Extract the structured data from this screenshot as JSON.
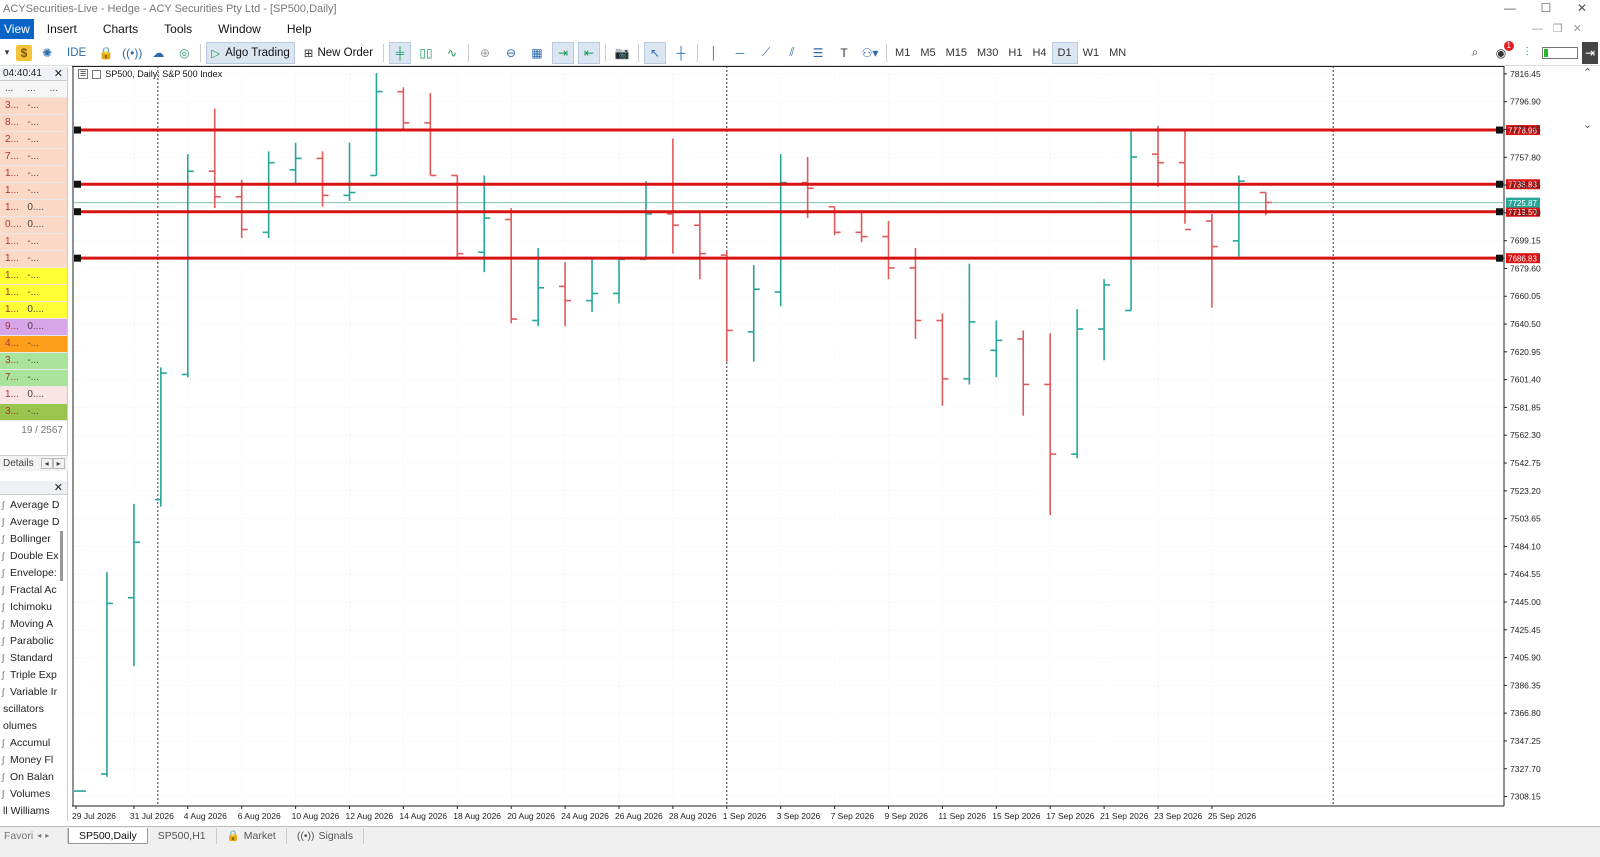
{
  "window": {
    "title": "ACYSecurities-Live - Hedge - ACY Securities Pty Ltd - [SP500,Daily]",
    "controls": [
      "—",
      "☐",
      "✕"
    ],
    "mdi_controls": [
      "—",
      "❐",
      "✕"
    ]
  },
  "menu": [
    "View",
    "Insert",
    "Charts",
    "Tools",
    "Window",
    "Help"
  ],
  "toolbar": {
    "ide": "IDE",
    "algo_trading": "Algo Trading",
    "new_order": "New Order",
    "timeframes": [
      "M1",
      "M5",
      "M15",
      "M30",
      "H1",
      "H4",
      "D1",
      "W1",
      "MN"
    ],
    "active_timeframe": "D1",
    "notification_count": "1"
  },
  "market_watch": {
    "time": "04:40:41",
    "headers": [
      "...",
      "...",
      "..."
    ],
    "rows": [
      {
        "a": "3...",
        "b": "-...",
        "color": "#fbd9c6"
      },
      {
        "a": "8...",
        "b": "-...",
        "color": "#fbd9c6"
      },
      {
        "a": "2...",
        "b": "-...",
        "color": "#fbd9c6"
      },
      {
        "a": "7...",
        "b": "-...",
        "color": "#fbd9c6"
      },
      {
        "a": "1...",
        "b": "-...",
        "color": "#fbd9c6"
      },
      {
        "a": "1...",
        "b": "-...",
        "color": "#fbd9c6"
      },
      {
        "a": "1...",
        "b": "0....",
        "color": "#fbd9c6"
      },
      {
        "a": "0....",
        "b": "0....",
        "color": "#fbd9c6"
      },
      {
        "a": "1...",
        "b": "-...",
        "color": "#fbd9c6"
      },
      {
        "a": "1...",
        "b": "-...",
        "color": "#fbd9c6"
      },
      {
        "a": "1...",
        "b": "-...",
        "color": "#ffff33"
      },
      {
        "a": "1...",
        "b": "-...",
        "color": "#ffff33"
      },
      {
        "a": "1...",
        "b": "0....",
        "color": "#ffff33"
      },
      {
        "a": "9...",
        "b": "0....",
        "color": "#d7a6e8"
      },
      {
        "a": "4...",
        "b": "-...",
        "color": "#ff9e1a"
      },
      {
        "a": "3...",
        "b": "-...",
        "color": "#a9e49a"
      },
      {
        "a": "7...",
        "b": "-...",
        "color": "#a9e49a"
      },
      {
        "a": "1...",
        "b": "0....",
        "color": "#fde4e4"
      },
      {
        "a": "3...",
        "b": "-...",
        "color": "#99c44d"
      }
    ],
    "count": "19 / 2567",
    "details_tab": "Details"
  },
  "navigator": {
    "items": [
      {
        "label": "Average D",
        "indent": true
      },
      {
        "label": "Average D",
        "indent": true
      },
      {
        "label": "Bollinger",
        "indent": true
      },
      {
        "label": "Double Ex",
        "indent": true
      },
      {
        "label": "Envelope:",
        "indent": true
      },
      {
        "label": "Fractal Ac",
        "indent": true
      },
      {
        "label": "Ichimoku",
        "indent": true
      },
      {
        "label": "Moving A",
        "indent": true
      },
      {
        "label": "Parabolic",
        "indent": true
      },
      {
        "label": "Standard",
        "indent": true
      },
      {
        "label": "Triple Exp",
        "indent": true
      },
      {
        "label": "Variable Ir",
        "indent": true
      },
      {
        "label": "scillators",
        "indent": false
      },
      {
        "label": "olumes",
        "indent": false
      },
      {
        "label": "Accumul",
        "indent": true
      },
      {
        "label": "Money Fl",
        "indent": true
      },
      {
        "label": "On Balan",
        "indent": true
      },
      {
        "label": "Volumes",
        "indent": true
      },
      {
        "label": "ll Williams",
        "indent": false
      }
    ]
  },
  "bottom_tabs": {
    "favorites": "Favori",
    "tabs": [
      "SP500,Daily",
      "SP500,H1",
      "Market",
      "Signals"
    ],
    "active": "SP500,Daily"
  },
  "chart_data": {
    "type": "bar",
    "symbol_label": "SP500, Daily:  S&P 500 Index",
    "colors": {
      "up": "#26a69a",
      "down": "#e05a5a",
      "level_line": "#d81313",
      "bid_line": "#7fbfb0",
      "current_tag": "#26a69a"
    },
    "y_ticks": [
      7816.45,
      7796.9,
      7777.35,
      7757.8,
      7738.25,
      7718.7,
      7699.15,
      7679.6,
      7660.05,
      7640.5,
      7620.95,
      7601.4,
      7581.85,
      7562.3,
      7542.75,
      7523.2,
      7503.65,
      7484.1,
      7464.55,
      7445.0,
      7425.45,
      7405.9,
      7386.35,
      7366.8,
      7347.25,
      7327.7,
      7308.15
    ],
    "ylim": [
      7301.5,
      7822.0
    ],
    "x_labels": [
      "29 Jul 2026",
      "31 Jul 2026",
      "4 Aug 2026",
      "6 Aug 2026",
      "10 Aug 2026",
      "12 Aug 2026",
      "14 Aug 2026",
      "18 Aug 2026",
      "20 Aug 2026",
      "24 Aug 2026",
      "26 Aug 2026",
      "28 Aug 2026",
      "1 Sep 2026",
      "3 Sep 2026",
      "7 Sep 2026",
      "9 Sep 2026",
      "11 Sep 2026",
      "15 Sep 2026",
      "17 Sep 2026",
      "21 Sep 2026",
      "23 Sep 2026",
      "25 Sep 2026"
    ],
    "x_label_bars": [
      0,
      2,
      4,
      6,
      8,
      10,
      12,
      14,
      16,
      18,
      20,
      22,
      24,
      26,
      28,
      30,
      32,
      34,
      36,
      38,
      40,
      42
    ],
    "vlines_at_bar": [
      3,
      24,
      46.5
    ],
    "horizontal_levels": [
      7776.96,
      7738.83,
      7719.5,
      7686.83
    ],
    "level_labels": [
      "7776.96",
      "7738.83",
      "7719.50",
      "7686.83"
    ],
    "current_price": 7725.87,
    "current_label": "7725.87",
    "bars": [
      {
        "o": 7312,
        "h": 7312,
        "l": 7312,
        "c": 7312
      },
      {
        "o": 7324,
        "h": 7466,
        "l": 7322,
        "c": 7444
      },
      {
        "o": 7448,
        "h": 7514,
        "l": 7400,
        "c": 7487
      },
      {
        "o": 7517,
        "h": 7610,
        "l": 7512,
        "c": 7606
      },
      {
        "o": 7605,
        "h": 7760,
        "l": 7603,
        "c": 7748
      },
      {
        "o": 7748,
        "h": 7792,
        "l": 7722,
        "c": 7730
      },
      {
        "o": 7730,
        "h": 7742,
        "l": 7701,
        "c": 7707
      },
      {
        "o": 7705,
        "h": 7762,
        "l": 7701,
        "c": 7754
      },
      {
        "o": 7749,
        "h": 7768,
        "l": 7738,
        "c": 7757
      },
      {
        "o": 7757,
        "h": 7762,
        "l": 7723,
        "c": 7731
      },
      {
        "o": 7731,
        "h": 7768,
        "l": 7727,
        "c": 7733
      },
      {
        "o": 7745,
        "h": 7817,
        "l": 7745,
        "c": 7804
      },
      {
        "o": 7804,
        "h": 7807,
        "l": 7776,
        "c": 7782
      },
      {
        "o": 7782,
        "h": 7803,
        "l": 7745,
        "c": 7745
      },
      {
        "o": 7745,
        "h": 7745,
        "l": 7686,
        "c": 7690
      },
      {
        "o": 7691,
        "h": 7745,
        "l": 7677,
        "c": 7715
      },
      {
        "o": 7714,
        "h": 7722,
        "l": 7641,
        "c": 7644
      },
      {
        "o": 7643,
        "h": 7694,
        "l": 7639,
        "c": 7666
      },
      {
        "o": 7667,
        "h": 7684,
        "l": 7639,
        "c": 7657
      },
      {
        "o": 7657,
        "h": 7687,
        "l": 7649,
        "c": 7662
      },
      {
        "o": 7662,
        "h": 7686,
        "l": 7655,
        "c": 7686
      },
      {
        "o": 7686,
        "h": 7741,
        "l": 7686,
        "c": 7718
      },
      {
        "o": 7718,
        "h": 7771,
        "l": 7690,
        "c": 7710
      },
      {
        "o": 7710,
        "h": 7719,
        "l": 7672,
        "c": 7690
      },
      {
        "o": 7689,
        "h": 7692,
        "l": 7614,
        "c": 7636
      },
      {
        "o": 7635,
        "h": 7682,
        "l": 7614,
        "c": 7665
      },
      {
        "o": 7663,
        "h": 7760,
        "l": 7653,
        "c": 7740
      },
      {
        "o": 7740,
        "h": 7758,
        "l": 7715,
        "c": 7736
      },
      {
        "o": 7723,
        "h": 7723,
        "l": 7703,
        "c": 7705
      },
      {
        "o": 7705,
        "h": 7719,
        "l": 7698,
        "c": 7702
      },
      {
        "o": 7702,
        "h": 7713,
        "l": 7672,
        "c": 7680
      },
      {
        "o": 7680,
        "h": 7694,
        "l": 7630,
        "c": 7643
      },
      {
        "o": 7643,
        "h": 7648,
        "l": 7583,
        "c": 7602
      },
      {
        "o": 7602,
        "h": 7683,
        "l": 7598,
        "c": 7642
      },
      {
        "o": 7622,
        "h": 7643,
        "l": 7603,
        "c": 7629
      },
      {
        "o": 7630,
        "h": 7636,
        "l": 7576,
        "c": 7598
      },
      {
        "o": 7598,
        "h": 7634,
        "l": 7506,
        "c": 7549
      },
      {
        "o": 7549,
        "h": 7651,
        "l": 7546,
        "c": 7637
      },
      {
        "o": 7637,
        "h": 7672,
        "l": 7615,
        "c": 7668
      },
      {
        "o": 7650,
        "h": 7777,
        "l": 7650,
        "c": 7758
      },
      {
        "o": 7760,
        "h": 7780,
        "l": 7737,
        "c": 7754
      },
      {
        "o": 7754,
        "h": 7777,
        "l": 7711,
        "c": 7707
      },
      {
        "o": 7713,
        "h": 7718,
        "l": 7652,
        "c": 7695
      },
      {
        "o": 7699,
        "h": 7745,
        "l": 7688,
        "c": 7741
      },
      {
        "o": 7733,
        "h": 7733,
        "l": 7717,
        "c": 7726
      }
    ]
  }
}
